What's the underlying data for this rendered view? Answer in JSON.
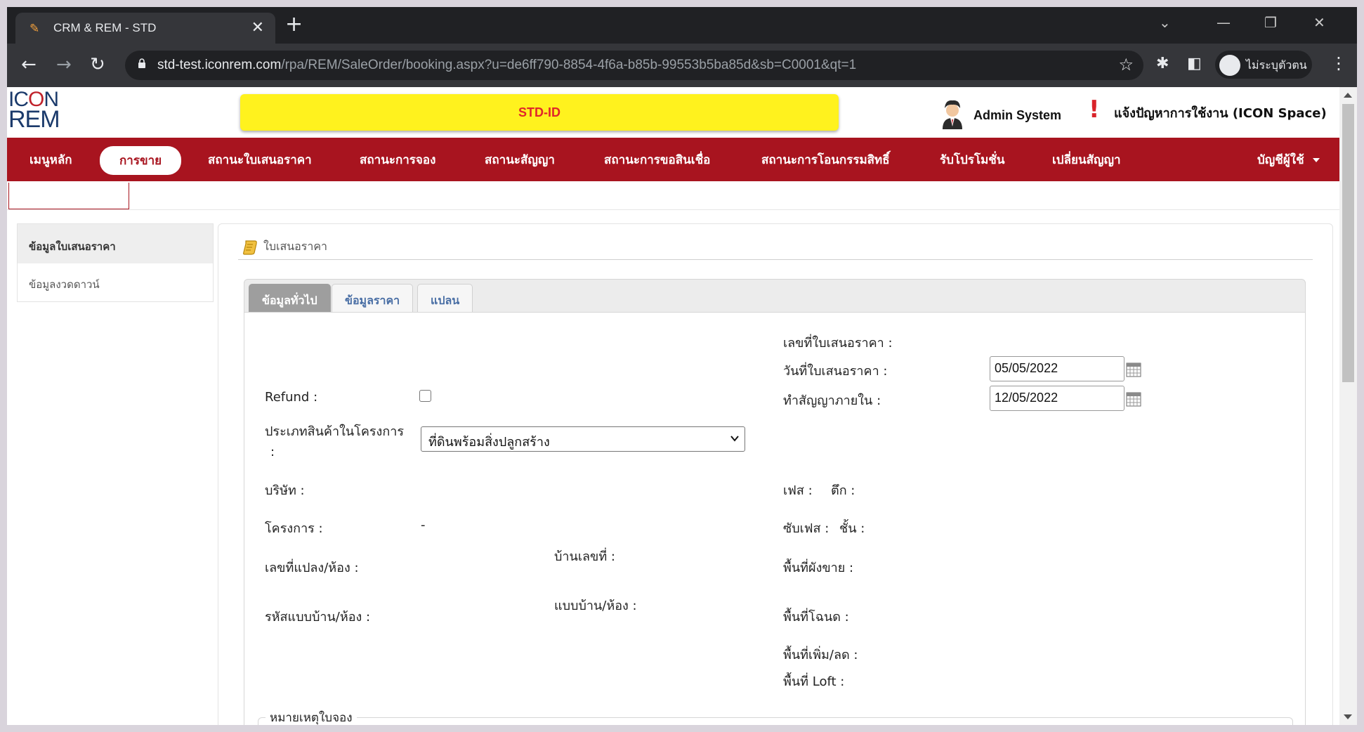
{
  "browser": {
    "tab_title": "CRM & REM - STD",
    "new_tab": "+",
    "url_host": "std-test.iconrem.com",
    "url_path": "/rpa/REM/SaleOrder/booking.aspx?u=de6ff790-8854-4f6a-b85b-99553b5ba85d&sb=C0001&qt=1",
    "profile_name": "ไม่ระบุตัวตน",
    "icons": [
      "pencil-icon",
      "close-icon",
      "chevron-down-icon",
      "minimize-icon",
      "restore-icon",
      "back-icon",
      "forward-icon",
      "reload-icon",
      "lock-icon",
      "star-icon",
      "extensions-icon",
      "sidepanel-icon",
      "incognito-icon",
      "menu-icon"
    ]
  },
  "header": {
    "logo_line1_a": "IC",
    "logo_line1_o": "O",
    "logo_line1_b": "N",
    "logo_line2": "REM",
    "banner": "STD-ID",
    "user_name": "Admin System",
    "report_label": "แจ้งปัญหาการใช้งาน (ICON Space)",
    "accent_color": "#a8141f",
    "banner_color": "#fff21e"
  },
  "nav": {
    "items": [
      {
        "label": "เมนูหลัก"
      },
      {
        "label": "การขาย"
      },
      {
        "label": "สถานะใบเสนอราคา"
      },
      {
        "label": "สถานะการจอง"
      },
      {
        "label": "สถานะสัญญา"
      },
      {
        "label": "สถานะการขอสินเชื่อ"
      },
      {
        "label": "สถานะการโอนกรรมสิทธิ์"
      },
      {
        "label": "รับโปรโมชั่น"
      },
      {
        "label": "เปลี่ยนสัญญา"
      },
      {
        "label": "บัญชีผู้ใช้"
      }
    ],
    "active": "การขาย"
  },
  "sidebar": {
    "header": "ข้อมูลใบเสนอราคา",
    "item": "ข้อมูลงวดดาวน์"
  },
  "panel": {
    "title": "ใบเสนอราคา",
    "tabs": [
      "ข้อมูลทั่วไป",
      "ข้อมูลราคา",
      "แปลน"
    ],
    "active_tab": "ข้อมูลทั่วไป"
  },
  "form": {
    "quote_no_label": "เลขที่ใบเสนอราคา  :",
    "quote_date_label": "วันที่ใบเสนอราคา  :",
    "quote_date_value": "05/05/2022",
    "contract_within_label": "ทำสัญญาภายใน  :",
    "contract_within_value": "12/05/2022",
    "refund_label": "Refund :",
    "refund_checked": false,
    "product_type_label_1": "ประเภทสินค้าในโครงการ",
    "product_type_label_2": ":",
    "product_type_value": "ที่ดินพร้อมสิ่งปลูกสร้าง",
    "company_label": "บริษัท  :",
    "phase_label": "เฟส  :",
    "building_label": "ตึก  :",
    "project_label": "โครงการ  :",
    "project_value": "-",
    "subphase_label": "ซับเฟส  :",
    "floor_label": "ชั้น  :",
    "house_no_label": "บ้านเลขที่  :",
    "plot_label": "เลขที่แปลง/ห้อง  :",
    "sale_area_label": "พื้นที่ผังขาย  :",
    "house_type_label": "แบบบ้าน/ห้อง  :",
    "house_code_label": "รหัสแบบบ้าน/ห้อง  :",
    "deed_area_label": "พื้นที่โฉนด  :",
    "adj_area_label": "พื้นที่เพิ่ม/ลด  :",
    "loft_area_label": "พื้นที่ Loft  :",
    "remark_legend": "หมายเหตุใบจอง"
  }
}
